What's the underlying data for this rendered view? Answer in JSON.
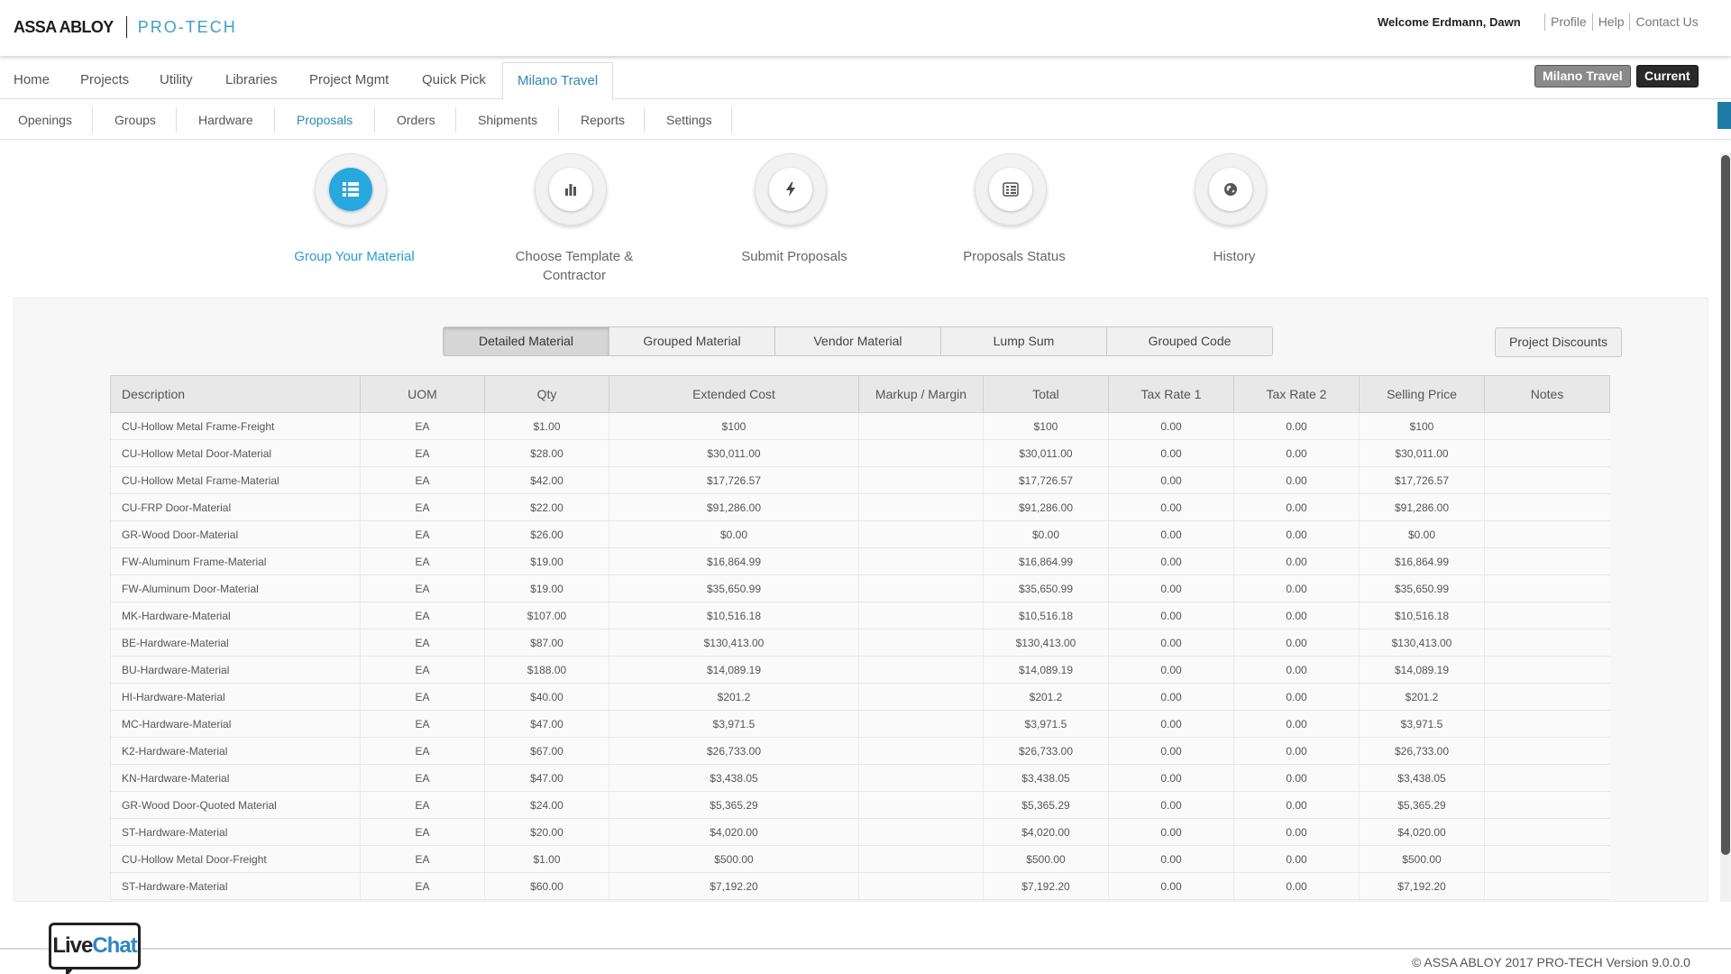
{
  "brand": {
    "company": "ASSA ABLOY",
    "product": "PRO-TECH"
  },
  "header": {
    "welcome": "Welcome Erdmann, Dawn",
    "links": [
      "Profile",
      "Help",
      "Contact Us"
    ]
  },
  "main_nav": {
    "items": [
      "Home",
      "Projects",
      "Utility",
      "Libraries",
      "Project Mgmt",
      "Quick Pick",
      "Milano Travel"
    ],
    "active": "Milano Travel",
    "project_button": "Milano Travel",
    "status_button": "Current"
  },
  "sub_nav": {
    "items": [
      "Openings",
      "Groups",
      "Hardware",
      "Proposals",
      "Orders",
      "Shipments",
      "Reports",
      "Settings"
    ],
    "active": "Proposals"
  },
  "steps": [
    {
      "label": "Group Your Material",
      "icon": "list-icon",
      "active": true
    },
    {
      "label": "Choose Template & Contractor",
      "icon": "bar-chart-icon",
      "active": false
    },
    {
      "label": "Submit Proposals",
      "icon": "lightning-icon",
      "active": false
    },
    {
      "label": "Proposals Status",
      "icon": "status-list-icon",
      "active": false
    },
    {
      "label": "History",
      "icon": "globe-icon",
      "active": false
    }
  ],
  "view_tabs": {
    "items": [
      "Detailed Material",
      "Grouped Material",
      "Vendor Material",
      "Lump Sum",
      "Grouped Code"
    ],
    "active": "Detailed Material"
  },
  "project_discounts_label": "Project Discounts",
  "table": {
    "columns": [
      "Description",
      "UOM",
      "Qty",
      "Extended Cost",
      "Markup / Margin",
      "Total",
      "Tax Rate 1",
      "Tax Rate 2",
      "Selling Price",
      "Notes"
    ],
    "rows": [
      [
        "CU-Hollow Metal Frame-Freight",
        "EA",
        "$1.00",
        "$100",
        "",
        "$100",
        "0.00",
        "0.00",
        "$100",
        ""
      ],
      [
        "CU-Hollow Metal Door-Material",
        "EA",
        "$28.00",
        "$30,011.00",
        "",
        "$30,011.00",
        "0.00",
        "0.00",
        "$30,011.00",
        ""
      ],
      [
        "CU-Hollow Metal Frame-Material",
        "EA",
        "$42.00",
        "$17,726.57",
        "",
        "$17,726.57",
        "0.00",
        "0.00",
        "$17,726.57",
        ""
      ],
      [
        "CU-FRP Door-Material",
        "EA",
        "$22.00",
        "$91,286.00",
        "",
        "$91,286.00",
        "0.00",
        "0.00",
        "$91,286.00",
        ""
      ],
      [
        "GR-Wood Door-Material",
        "EA",
        "$26.00",
        "$0.00",
        "",
        "$0.00",
        "0.00",
        "0.00",
        "$0.00",
        ""
      ],
      [
        "FW-Aluminum Frame-Material",
        "EA",
        "$19.00",
        "$16,864.99",
        "",
        "$16,864.99",
        "0.00",
        "0.00",
        "$16,864.99",
        ""
      ],
      [
        "FW-Aluminum Door-Material",
        "EA",
        "$19.00",
        "$35,650.99",
        "",
        "$35,650.99",
        "0.00",
        "0.00",
        "$35,650.99",
        ""
      ],
      [
        "MK-Hardware-Material",
        "EA",
        "$107.00",
        "$10,516.18",
        "",
        "$10,516.18",
        "0.00",
        "0.00",
        "$10,516.18",
        ""
      ],
      [
        "BE-Hardware-Material",
        "EA",
        "$87.00",
        "$130,413.00",
        "",
        "$130,413.00",
        "0.00",
        "0.00",
        "$130,413.00",
        ""
      ],
      [
        "BU-Hardware-Material",
        "EA",
        "$188.00",
        "$14,089.19",
        "",
        "$14,089.19",
        "0.00",
        "0.00",
        "$14,089.19",
        ""
      ],
      [
        "HI-Hardware-Material",
        "EA",
        "$40.00",
        "$201.2",
        "",
        "$201.2",
        "0.00",
        "0.00",
        "$201.2",
        ""
      ],
      [
        "MC-Hardware-Material",
        "EA",
        "$47.00",
        "$3,971.5",
        "",
        "$3,971.5",
        "0.00",
        "0.00",
        "$3,971.5",
        ""
      ],
      [
        "K2-Hardware-Material",
        "EA",
        "$67.00",
        "$26,733.00",
        "",
        "$26,733.00",
        "0.00",
        "0.00",
        "$26,733.00",
        ""
      ],
      [
        "KN-Hardware-Material",
        "EA",
        "$47.00",
        "$3,438.05",
        "",
        "$3,438.05",
        "0.00",
        "0.00",
        "$3,438.05",
        ""
      ],
      [
        "GR-Wood Door-Quoted Material",
        "EA",
        "$24.00",
        "$5,365.29",
        "",
        "$5,365.29",
        "0.00",
        "0.00",
        "$5,365.29",
        ""
      ],
      [
        "ST-Hardware-Material",
        "EA",
        "$20.00",
        "$4,020.00",
        "",
        "$4,020.00",
        "0.00",
        "0.00",
        "$4,020.00",
        ""
      ],
      [
        "CU-Hollow Metal Door-Freight",
        "EA",
        "$1.00",
        "$500.00",
        "",
        "$500.00",
        "0.00",
        "0.00",
        "$500.00",
        ""
      ],
      [
        "ST-Hardware-Material",
        "EA",
        "$60.00",
        "$7,192.20",
        "",
        "$7,192.20",
        "0.00",
        "0.00",
        "$7,192.20",
        ""
      ]
    ]
  },
  "footer": {
    "copyright": "© ASSA ABLOY 2017 PRO-TECH Version 9.0.0.0",
    "livechat_live": "Live",
    "livechat_chat": "Chat"
  },
  "colors": {
    "accent": "#2b8ab3",
    "active_step": "#29a8e0",
    "edge_tab": "#1f7ca8"
  }
}
